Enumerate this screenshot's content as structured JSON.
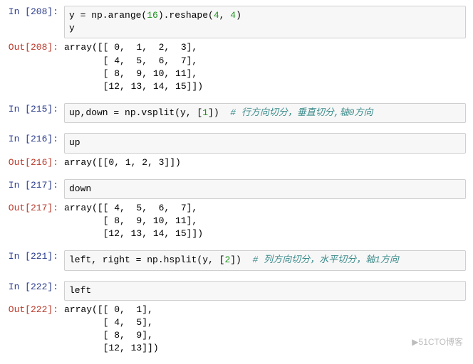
{
  "cells": [
    {
      "num": "208",
      "in_pre": "y = np.arange(",
      "in_n1": "16",
      "in_mid": ").reshape(",
      "in_n2": "4",
      "in_sep": ", ",
      "in_n3": "4",
      "in_post": ")\ny",
      "out": "array([[ 0,  1,  2,  3],\n       [ 4,  5,  6,  7],\n       [ 8,  9, 10, 11],\n       [12, 13, 14, 15]])"
    },
    {
      "num": "215",
      "in_pre": "up,down = np.vsplit(y, [",
      "in_n1": "1",
      "in_post": "])  ",
      "comment": "# 行方向切分，垂直切分,轴0方向"
    },
    {
      "num": "216",
      "in_pre": "up",
      "out": "array([[0, 1, 2, 3]])"
    },
    {
      "num": "217",
      "in_pre": "down",
      "out": "array([[ 4,  5,  6,  7],\n       [ 8,  9, 10, 11],\n       [12, 13, 14, 15]])"
    },
    {
      "num": "221",
      "in_pre": "left, right = np.hsplit(y, [",
      "in_n1": "2",
      "in_post": "])  ",
      "comment": "# 列方向切分，水平切分，轴1方向"
    },
    {
      "num": "222",
      "in_pre": "left",
      "out": "array([[ 0,  1],\n       [ 4,  5],\n       [ 8,  9],\n       [12, 13]])"
    }
  ],
  "labels": {
    "in": "In ",
    "out": "Out"
  },
  "watermark": "▶51CTO博客"
}
